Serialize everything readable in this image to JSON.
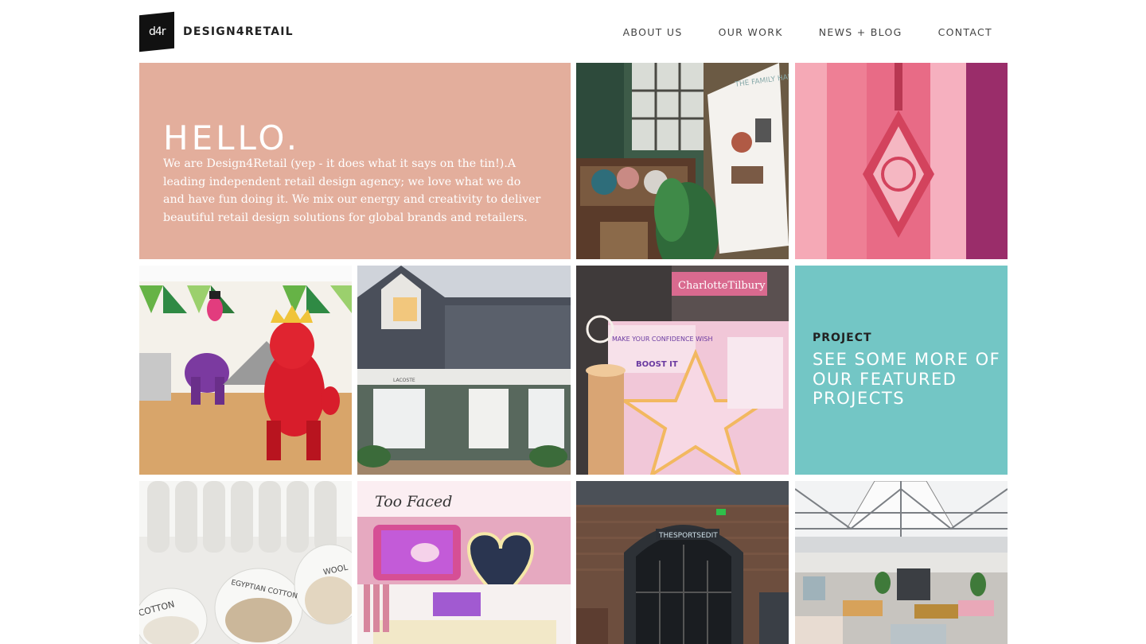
{
  "header": {
    "logo_mark": "d4r",
    "brand": "DESIGN4RETAIL",
    "nav": [
      "ABOUT US",
      "OUR WORK",
      "NEWS + BLOG",
      "CONTACT"
    ]
  },
  "hero": {
    "title": "HELLO.",
    "body": "We are Design4Retail (yep - it does what it says on the tin!).A leading independent retail design agency; we love what we do and have fun doing it. We mix our energy and creativity to deliver beautiful retail design solutions for global brands and retailers."
  },
  "project_tile": {
    "kicker": "PROJECT",
    "link": "SEE SOME MORE OF OUR FEATURED PROJECTS"
  },
  "photo_text": {
    "family_hangout": "THE FAMILY HANGOUT",
    "lacoste": "LACOSTE",
    "charlotte_tilbury": "CharlotteTilbury",
    "confidence": "MAKE YOUR CONFIDENCE WISH",
    "boost": "BOOST IT",
    "too_faced": "Too Faced",
    "sportsedit": "THESPORTSEDIT",
    "cotton": "COTTON",
    "egyptian_cotton": "EGYPTIAN COTTON",
    "wool": "WOOL"
  },
  "colors": {
    "hero_bg": "#e3ae9c",
    "project_bg": "#73c6c5"
  }
}
